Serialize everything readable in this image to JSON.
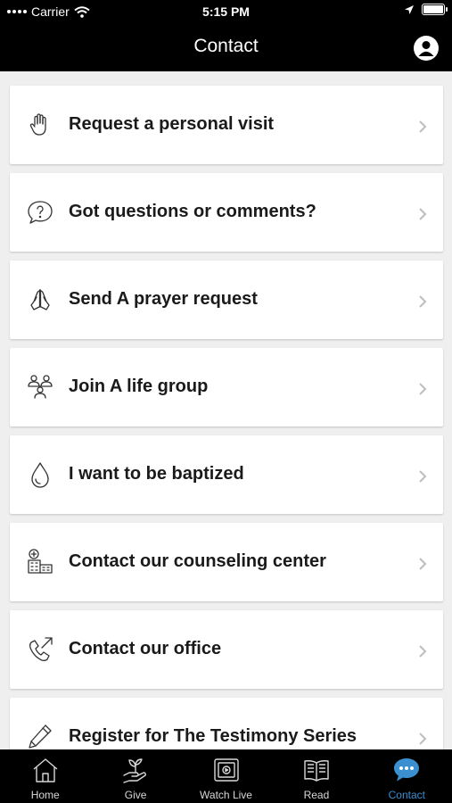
{
  "status_bar": {
    "carrier": "Carrier",
    "time": "5:15 PM"
  },
  "nav": {
    "title": "Contact",
    "profile_icon": "person-circle-icon"
  },
  "rows": [
    {
      "label": "Request a personal visit",
      "icon": "hand-icon"
    },
    {
      "label": "Got questions or comments?",
      "icon": "speech-question-icon"
    },
    {
      "label": "Send A prayer request",
      "icon": "praying-hands-icon"
    },
    {
      "label": "Join A life group",
      "icon": "group-icon"
    },
    {
      "label": "I want to be baptized",
      "icon": "water-drop-icon"
    },
    {
      "label": "Contact our counseling center",
      "icon": "hospital-icon"
    },
    {
      "label": "Contact our office",
      "icon": "phone-icon"
    },
    {
      "label": "Register for The Testimony Series",
      "icon": "pen-icon"
    }
  ],
  "tabs": [
    {
      "label": "Home",
      "icon": "house-icon"
    },
    {
      "label": "Give",
      "icon": "hand-plant-icon"
    },
    {
      "label": "Watch Live",
      "icon": "tv-icon"
    },
    {
      "label": "Read",
      "icon": "book-icon"
    },
    {
      "label": "Contact",
      "icon": "chat-bubble-icon",
      "active": true
    }
  ],
  "colors": {
    "bar_background": "#000000",
    "list_background": "#efefef",
    "active_tab": "#3a8fd0",
    "inactive_tab": "#d8d8d8"
  }
}
